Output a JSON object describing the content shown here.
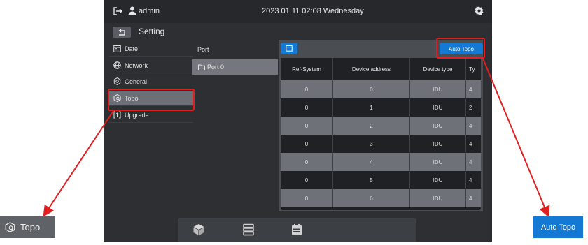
{
  "topbar": {
    "user": "admin",
    "datetime": "2023 01 11 02:08 Wednesday"
  },
  "subbar": {
    "title": "Setting"
  },
  "sidebar": {
    "items": [
      {
        "label": "Date",
        "icon": "calendar-icon"
      },
      {
        "label": "Network",
        "icon": "globe-icon"
      },
      {
        "label": "General",
        "icon": "gear-icon"
      },
      {
        "label": "Topo",
        "icon": "topo-icon",
        "active": true
      },
      {
        "label": "Upgrade",
        "icon": "upgrade-icon"
      }
    ]
  },
  "ports": {
    "header": "Port",
    "items": [
      {
        "label": "Port 0",
        "icon": "folder-icon"
      }
    ]
  },
  "panel": {
    "auto_topo_label": "Auto Topo",
    "columns": [
      "Ref-System",
      "Device address",
      "Device type",
      "Ty"
    ],
    "rows": [
      [
        "0",
        "0",
        "IDU",
        "4"
      ],
      [
        "0",
        "1",
        "IDU",
        "2"
      ],
      [
        "0",
        "2",
        "IDU",
        "4"
      ],
      [
        "0",
        "3",
        "IDU",
        "4"
      ],
      [
        "0",
        "4",
        "IDU",
        "4"
      ],
      [
        "0",
        "5",
        "IDU",
        "4"
      ],
      [
        "0",
        "6",
        "IDU",
        "4"
      ]
    ]
  },
  "bottombar": {
    "icons": [
      "cube-icon",
      "server-icon",
      "calendar-board-icon"
    ]
  },
  "callouts": {
    "topo_label": "Topo",
    "auto_topo_label": "Auto Topo"
  },
  "colors": {
    "accent": "#1479d3",
    "highlight": "#e02020",
    "background": "#2d2f33"
  }
}
